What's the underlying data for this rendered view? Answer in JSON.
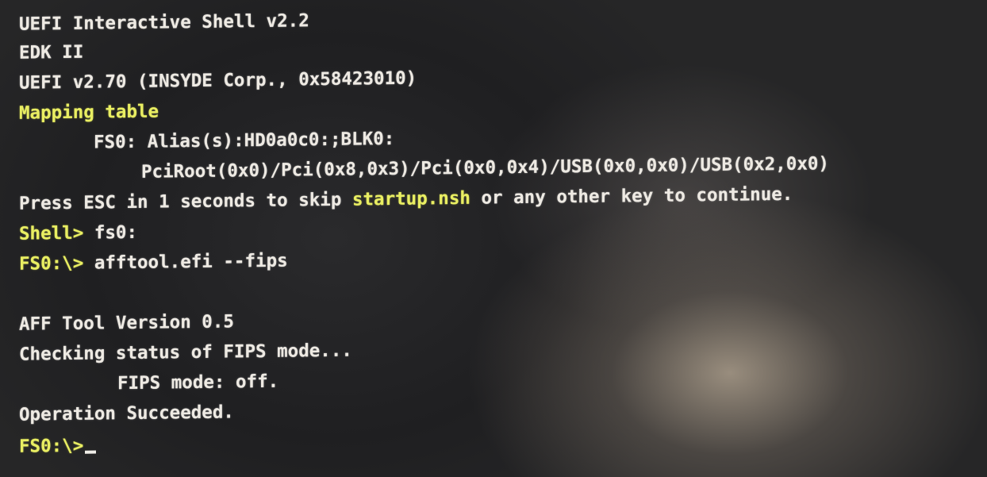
{
  "lines": {
    "l1": "UEFI Interactive Shell v2.2",
    "l2": "EDK II",
    "l3": "UEFI v2.70 (INSYDE Corp., 0x58423010)",
    "l4": "Mapping table",
    "l5": "FS0: Alias(s):HD0a0c0:;BLK0:",
    "l6": "PciRoot(0x0)/Pci(0x8,0x3)/Pci(0x0,0x4)/USB(0x0,0x0)/USB(0x2,0x0)",
    "l7a": "Press ESC in 1 seconds to skip ",
    "l7b": "startup.nsh",
    "l7c": " or any other key to continue.",
    "l8a": "Shell> ",
    "l8b": "fs0:",
    "l9a": "FS0:\\> ",
    "l9b": "afftool.efi --fips",
    "l10": "AFF Tool Version 0.5",
    "l11": "Checking status of FIPS mode...",
    "l12": "FIPS mode: off.",
    "l13": "Operation Succeeded.",
    "l14": "FS0:\\>"
  },
  "colors": {
    "text": "#eeeae3",
    "highlight": "#e9ee62",
    "background": "#222224"
  }
}
